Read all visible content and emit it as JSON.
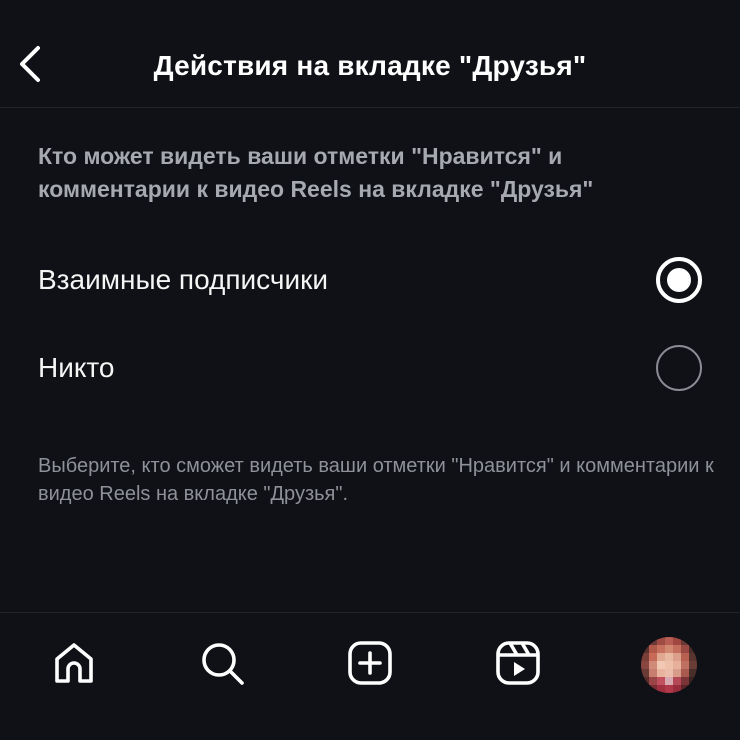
{
  "header": {
    "title": "Действия на вкладке \"Друзья\""
  },
  "section": {
    "heading": "Кто может видеть ваши отметки \"Нравится\" и комментарии к видео Reels на вкладке \"Друзья\""
  },
  "options": [
    {
      "label": "Взаимные подписчики",
      "selected": true
    },
    {
      "label": "Никто",
      "selected": false
    }
  ],
  "footnote": "Выберите, кто сможет видеть ваши отметки \"Нравится\" и комментарии к видео Reels на вкладке \"Друзья\".",
  "bottom_nav": {
    "items": [
      {
        "icon": "home-icon"
      },
      {
        "icon": "search-icon"
      },
      {
        "icon": "create-post-icon"
      },
      {
        "icon": "reels-icon"
      },
      {
        "icon": "profile-avatar"
      }
    ]
  },
  "colors": {
    "background": "#0f1116",
    "primary_text": "#f5f5f5",
    "secondary_text": "#a6a9af",
    "divider": "#23252b"
  }
}
